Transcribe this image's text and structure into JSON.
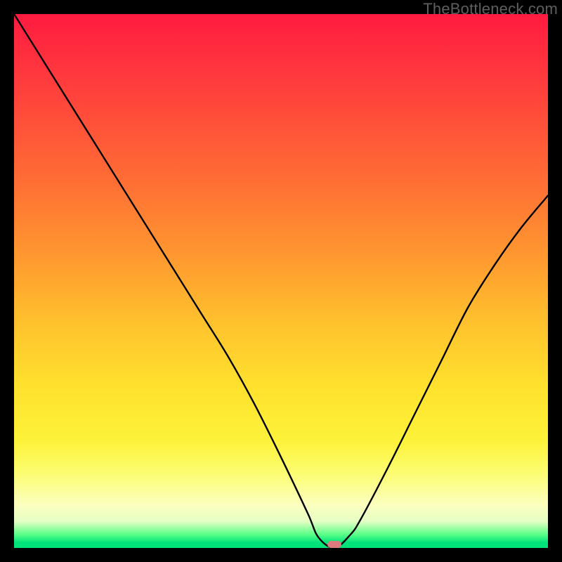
{
  "watermark": "TheBottleneck.com",
  "colors": {
    "frame": "#000000",
    "curve": "#000000",
    "minpoint": "#dd7a7d",
    "gradient_top": "#ff1b40",
    "gradient_mid": "#ffe22d",
    "gradient_bottom": "#00e27a"
  },
  "chart_data": {
    "type": "line",
    "title": "",
    "xlabel": "",
    "ylabel": "",
    "xlim": [
      0,
      100
    ],
    "ylim": [
      0,
      100
    ],
    "grid": false,
    "legend": false,
    "annotations": [
      {
        "type": "marker",
        "x": 60,
        "y": 0,
        "label": "minimum",
        "color": "#dd7a7d"
      }
    ],
    "series": [
      {
        "name": "bottleneck-curve",
        "x": [
          0,
          5,
          10,
          15,
          20,
          25,
          30,
          35,
          40,
          45,
          50,
          55,
          57,
          60,
          63,
          65,
          70,
          75,
          80,
          85,
          90,
          95,
          100
        ],
        "values": [
          100,
          92,
          84,
          76,
          68,
          60,
          52,
          44,
          36,
          27,
          17,
          6.5,
          2.0,
          0,
          2.5,
          5.5,
          15,
          25,
          35,
          45,
          53,
          60,
          66
        ]
      }
    ]
  }
}
